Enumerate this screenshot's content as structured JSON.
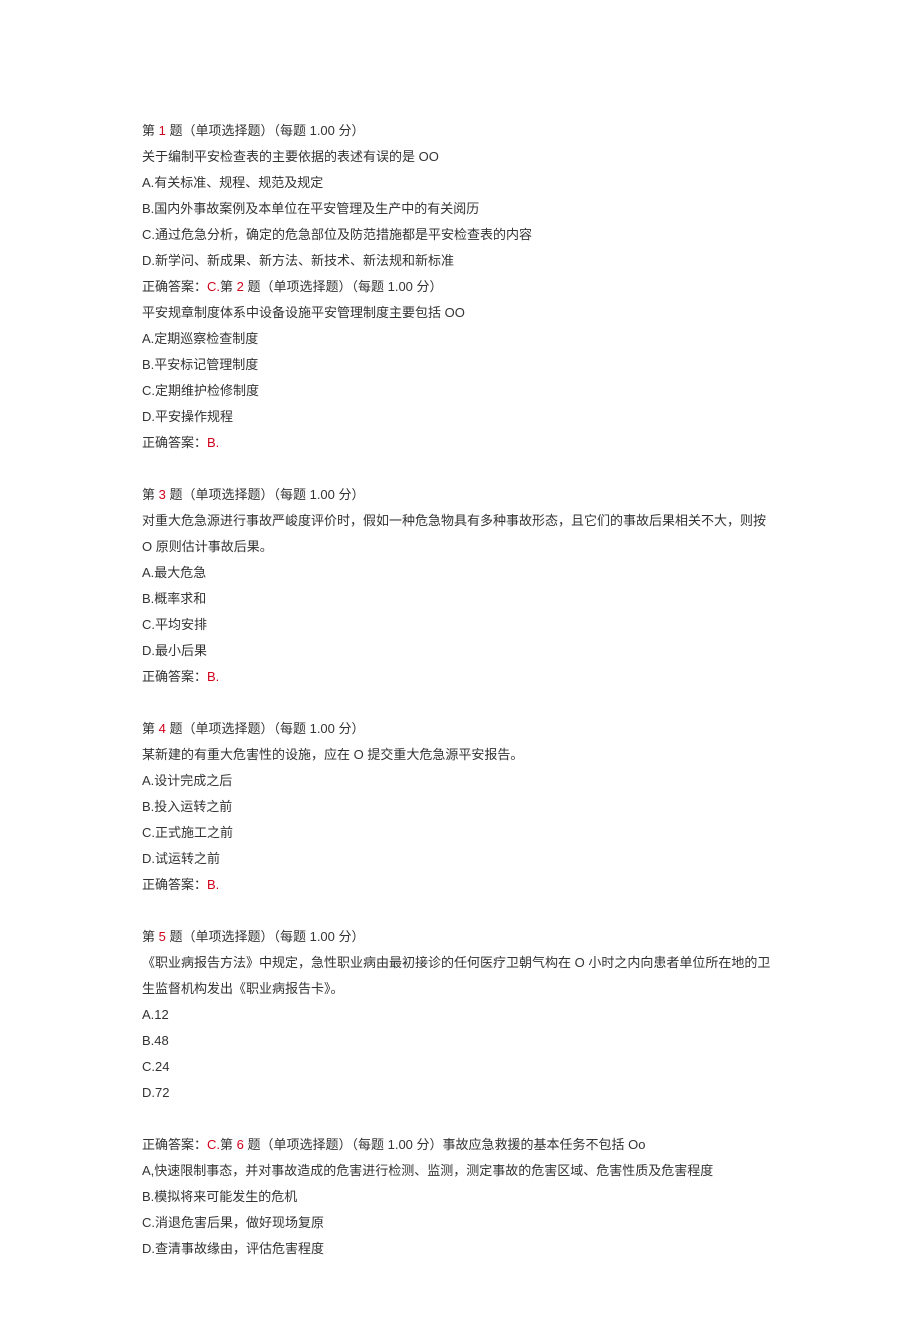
{
  "q1": {
    "prefix": "第 ",
    "num": "1",
    "after_num": " 题（单项选择题）（每题 1.00 分）",
    "stem": "关于编制平安检查表的主要依据的表述有误的是 OO",
    "A": "A.有关标准、规程、规范及规定",
    "B": "B.国内外事故案例及本单位在平安管理及生产中的有关阅历",
    "C": "C.通过危急分析，确定的危急部位及防范措施都是平安检查表的内容",
    "D": "D.新学问、新成果、新方法、新技术、新法规和新标准",
    "ans_label": "正确答案：",
    "ans": "C."
  },
  "q2": {
    "prefix": "第 ",
    "num": "2",
    "after_num": " 题（单项选择题）（每题 1.00 分）",
    "stem": "平安规章制度体系中设备设施平安管理制度主要包括 OO",
    "A": "A.定期巡察检查制度",
    "B": "B.平安标记管理制度",
    "C": "C.定期维护检修制度",
    "D": "D.平安操作规程",
    "ans_label": "正确答案：",
    "ans": "B."
  },
  "q3": {
    "prefix": "第 ",
    "num": "3",
    "after_num": " 题（单项选择题）（每题 1.00 分）",
    "stem": "对重大危急源进行事故严峻度评价时，假如一种危急物具有多种事故形态，且它们的事故后果相关不大，则按 O 原则估计事故后果。",
    "A": "A.最大危急",
    "B": "B.概率求和",
    "C": "C.平均安排",
    "D": "D.最小后果",
    "ans_label": "正确答案：",
    "ans": "B."
  },
  "q4": {
    "prefix": "第 ",
    "num": "4",
    "after_num": " 题（单项选择题）（每题 1.00 分）",
    "stem": "某新建的有重大危害性的设施，应在 O 提交重大危急源平安报告。",
    "A": "A.设计完成之后",
    "B": "B.投入运转之前",
    "C": "C.正式施工之前",
    "D": "D.试运转之前",
    "ans_label": "正确答案：",
    "ans": "B."
  },
  "q5": {
    "prefix": "第 ",
    "num": "5",
    "after_num": " 题（单项选择题）（每题 1.00 分）",
    "stem": "《职业病报告方法》中规定，急性职业病由最初接诊的任何医疗卫朝气构在 O 小时之内向患者单位所在地的卫生监督机构发出《职业病报告卡》。",
    "A": "A.12",
    "B": "B.48",
    "C": "C.24",
    "D": "D.72",
    "ans_label": "正确答案：",
    "ans": "C."
  },
  "q6": {
    "prefix": "第 ",
    "num": "6",
    "after_num": " 题（单项选择题）（每题 1.00 分）事故应急救援的基本任务不包括 Oo",
    "A": "A,快速限制事态，并对事故造成的危害进行检测、监测，测定事故的危害区域、危害性质及危害程度",
    "B": "B.模拟将来可能发生的危机",
    "C": "C.消退危害后果，做好现场复原",
    "D": "D.查清事故缘由，评估危害程度"
  }
}
